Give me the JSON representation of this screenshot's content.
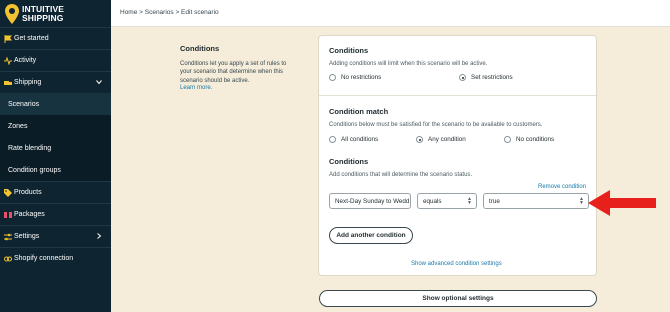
{
  "brand": {
    "line1": "INTUITIVE",
    "line2": "SHIPPING"
  },
  "sidebar": {
    "items": [
      {
        "label": "Get started"
      },
      {
        "label": "Activity"
      },
      {
        "label": "Shipping"
      },
      {
        "label": "Scenarios"
      },
      {
        "label": "Zones"
      },
      {
        "label": "Rate blending"
      },
      {
        "label": "Condition groups"
      },
      {
        "label": "Products"
      },
      {
        "label": "Packages"
      },
      {
        "label": "Settings"
      },
      {
        "label": "Shopify connection"
      }
    ]
  },
  "breadcrumb": "Home > Scenarios > Edit scenario",
  "description": {
    "title": "Conditions",
    "text": "Conditions let you apply a set of rules to your scenario that determine when this scenario should be active.",
    "link": "Learn more."
  },
  "conditions_section": {
    "title": "Conditions",
    "help": "Adding conditions will limit when this scenario will be active.",
    "options": [
      "No restrictions",
      "Set restrictions"
    ],
    "selected": "Set restrictions"
  },
  "match_section": {
    "title": "Condition match",
    "help": "Conditions below must be satisfied for the scenario to be available to customers.",
    "options": [
      "All conditions",
      "Any condition",
      "No conditions"
    ],
    "selected": "Any condition"
  },
  "rules_section": {
    "title": "Conditions",
    "help": "Add conditions that will determine the scenario status.",
    "remove_link": "Remove condition",
    "rule": {
      "field": "Next-Day Sunday to Wedd",
      "operator": "equals",
      "value": "true"
    },
    "add_button": "Add another condition",
    "advanced_link": "Show advanced condition settings"
  },
  "optional_button": "Show optional settings",
  "colors": {
    "sidebar": "#0e2430",
    "background": "#f5edda",
    "accent_link": "#1a7aa8",
    "arrow": "#e8201c",
    "logo": "#f2c230"
  }
}
